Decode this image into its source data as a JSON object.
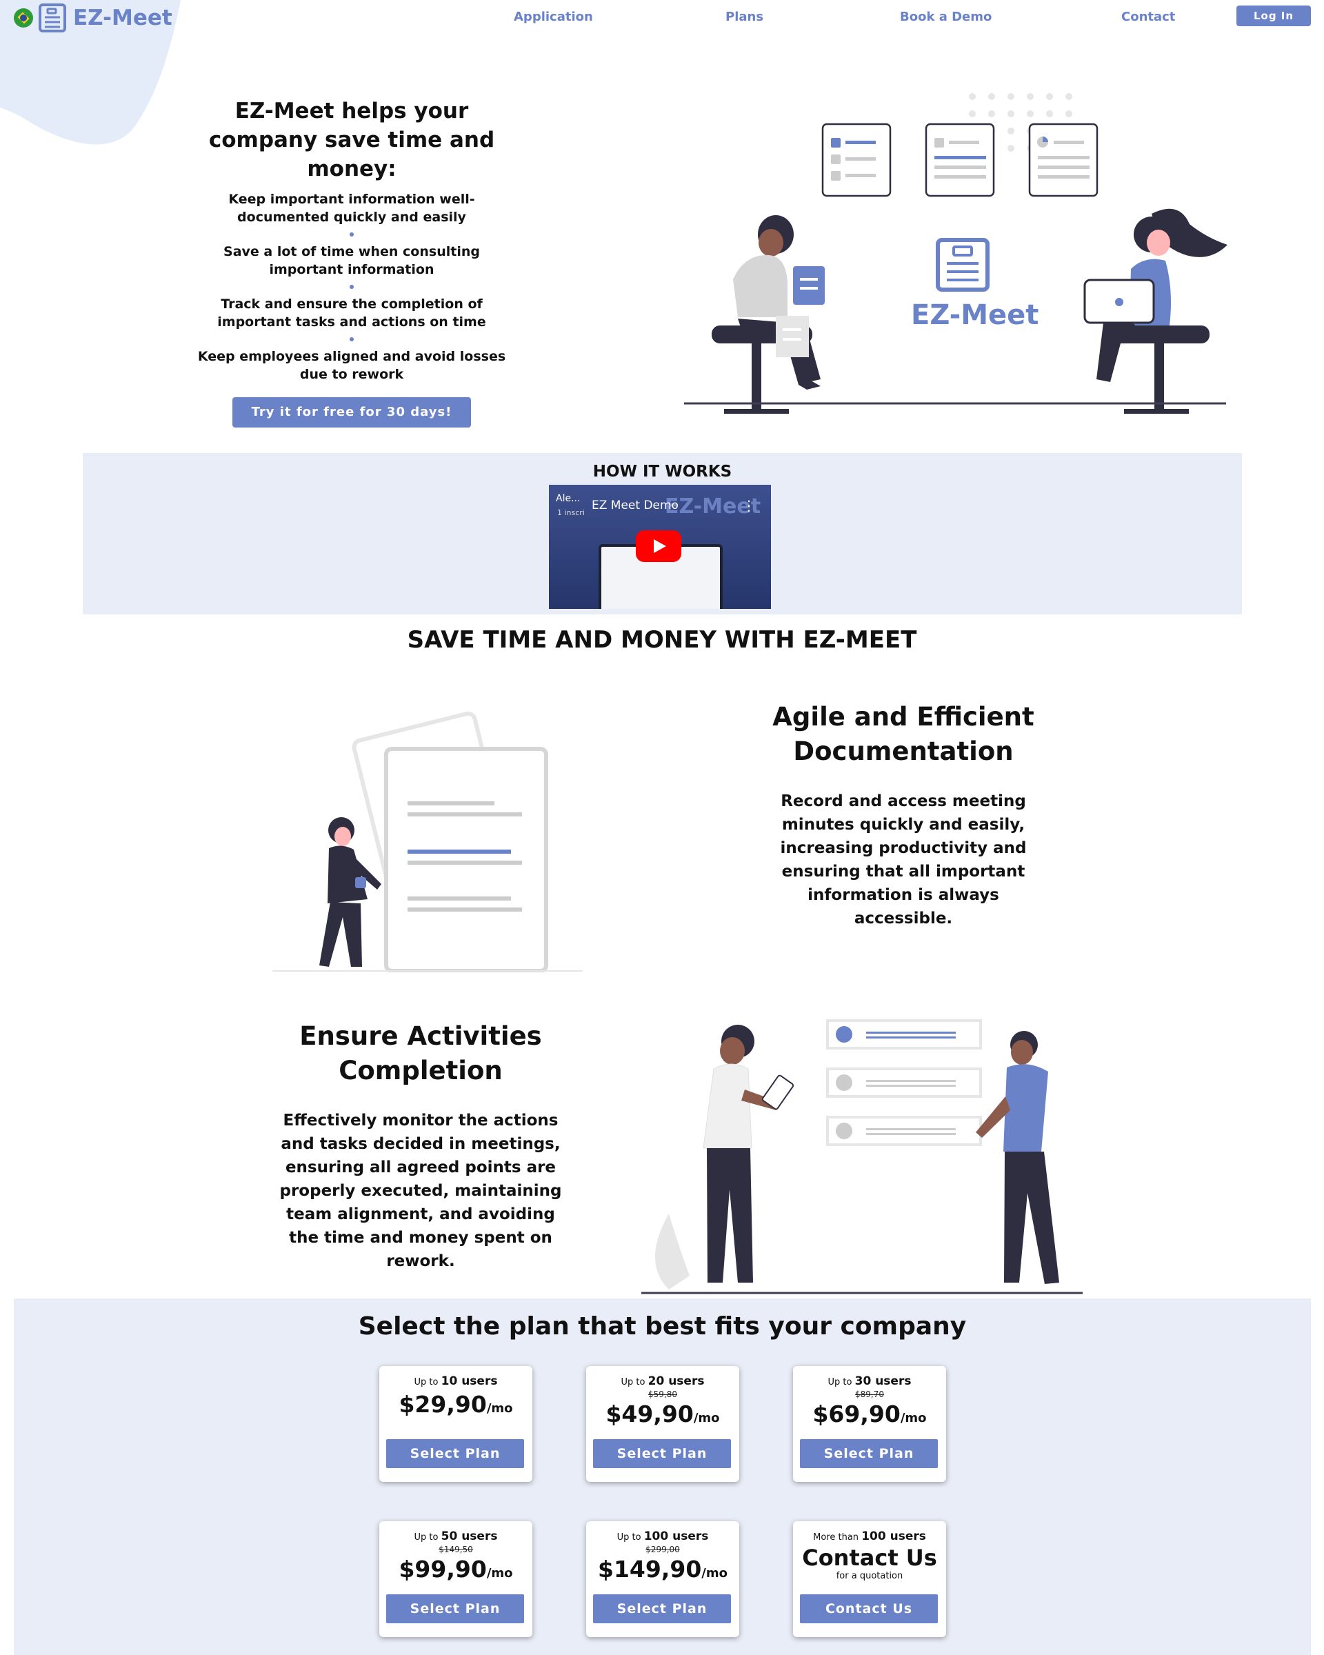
{
  "header": {
    "logo_text": "EZ-Meet",
    "nav": [
      "Application",
      "Plans",
      "Book a Demo",
      "Contact"
    ],
    "login_label": "Log In"
  },
  "hero": {
    "title": "EZ-Meet helps your company save time and money:",
    "benefits": [
      "Keep important information well-documented quickly and easily",
      "Save a lot of time when consulting important information",
      "Track and ensure the completion of important tasks and actions on time",
      "Keep employees aligned and avoid losses due to rework"
    ],
    "cta_label": "Try it for free for 30 days!",
    "art_logo_text": "EZ-Meet"
  },
  "how_it_works": {
    "title": "HOW IT WORKS",
    "video": {
      "channel": "Ale...",
      "subscribers": "1 inscri",
      "title": "EZ Meet Demo",
      "brand": "EZ-Meet"
    }
  },
  "save_section": {
    "title": "SAVE TIME AND MONEY WITH EZ-MEET"
  },
  "features": [
    {
      "title": "Agile and Efficient Documentation",
      "description": "Record and access meeting minutes quickly and easily, increasing productivity and ensuring that all important information is always accessible."
    },
    {
      "title": "Ensure Activities Completion",
      "description": "Effectively monitor the actions and tasks decided in meetings, ensuring all agreed points are properly executed, maintaining team alignment, and avoiding the time and money spent on rework."
    }
  ],
  "plans": {
    "title": "Select the plan that best fits your company",
    "cards": [
      {
        "prefix": "Up to",
        "users": "10 users",
        "old_price": "",
        "price": "$29,90",
        "unit": "/mo",
        "sub": "",
        "button": "Select Plan"
      },
      {
        "prefix": "Up to",
        "users": "20 users",
        "old_price": "$59,80",
        "price": "$49,90",
        "unit": "/mo",
        "sub": "",
        "button": "Select Plan"
      },
      {
        "prefix": "Up to",
        "users": "30 users",
        "old_price": "$89,70",
        "price": "$69,90",
        "unit": "/mo",
        "sub": "",
        "button": "Select Plan"
      },
      {
        "prefix": "Up to",
        "users": "50 users",
        "old_price": "$149,50",
        "price": "$99,90",
        "unit": "/mo",
        "sub": "",
        "button": "Select Plan"
      },
      {
        "prefix": "Up to",
        "users": "100 users",
        "old_price": "$299,00",
        "price": "$149,90",
        "unit": "/mo",
        "sub": "",
        "button": "Select Plan"
      },
      {
        "prefix": "More than",
        "users": "100 users",
        "old_price": "",
        "price": "Contact Us",
        "unit": "",
        "sub": "for a quotation",
        "button": "Contact Us"
      }
    ]
  },
  "colors": {
    "accent": "#6a82c8",
    "section_bg": "#e9edf7",
    "blob": "#e3ecf8",
    "dark": "#2f2e41"
  }
}
